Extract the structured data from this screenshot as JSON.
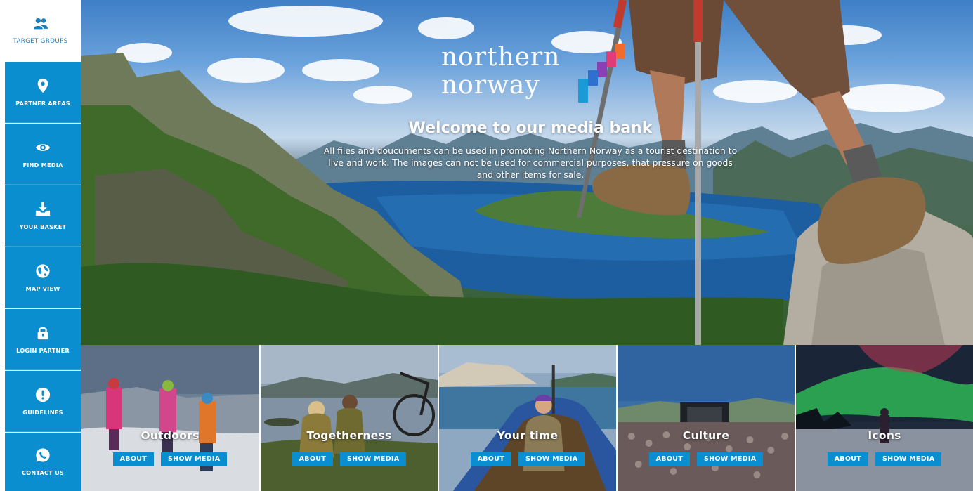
{
  "sidebar": {
    "items": [
      {
        "label": "TARGET GROUPS",
        "icon": "users-icon"
      },
      {
        "label": "PARTNER AREAS",
        "icon": "location-pin-icon"
      },
      {
        "label": "FIND MEDIA",
        "icon": "eye-icon"
      },
      {
        "label": "YOUR BASKET",
        "icon": "download-tray-icon"
      },
      {
        "label": "MAP VIEW",
        "icon": "globe-icon"
      },
      {
        "label": "LOGIN PARTNER",
        "icon": "lock-icon"
      },
      {
        "label": "GUIDELINES",
        "icon": "exclamation-icon"
      },
      {
        "label": "CONTACT US",
        "icon": "whatsapp-icon"
      }
    ]
  },
  "hero": {
    "logo_line1": "northern",
    "logo_line2": "norway",
    "title": "Welcome to our media bank",
    "intro": "All files and doucuments can be used in promoting Northern Norway as a tourist destination to live and work. The images can not be used for commercial purposes, that pressure on goods and other items for sale."
  },
  "tiles": [
    {
      "title": "Outdoors",
      "about": "ABOUT",
      "show": "SHOW MEDIA"
    },
    {
      "title": "Togetherness",
      "about": "ABOUT",
      "show": "SHOW MEDIA"
    },
    {
      "title": "Your time",
      "about": "ABOUT",
      "show": "SHOW MEDIA"
    },
    {
      "title": "Culture",
      "about": "ABOUT",
      "show": "SHOW MEDIA"
    },
    {
      "title": "Icons",
      "about": "ABOUT",
      "show": "SHOW MEDIA"
    }
  ],
  "colors": {
    "accent": "#0a8ecf",
    "sidebar_text_active": "#1a7fc0",
    "logo_mark": [
      "#f06b2c",
      "#e03c78",
      "#8a3fb5",
      "#2f6fd0",
      "#1c9ad6"
    ]
  }
}
